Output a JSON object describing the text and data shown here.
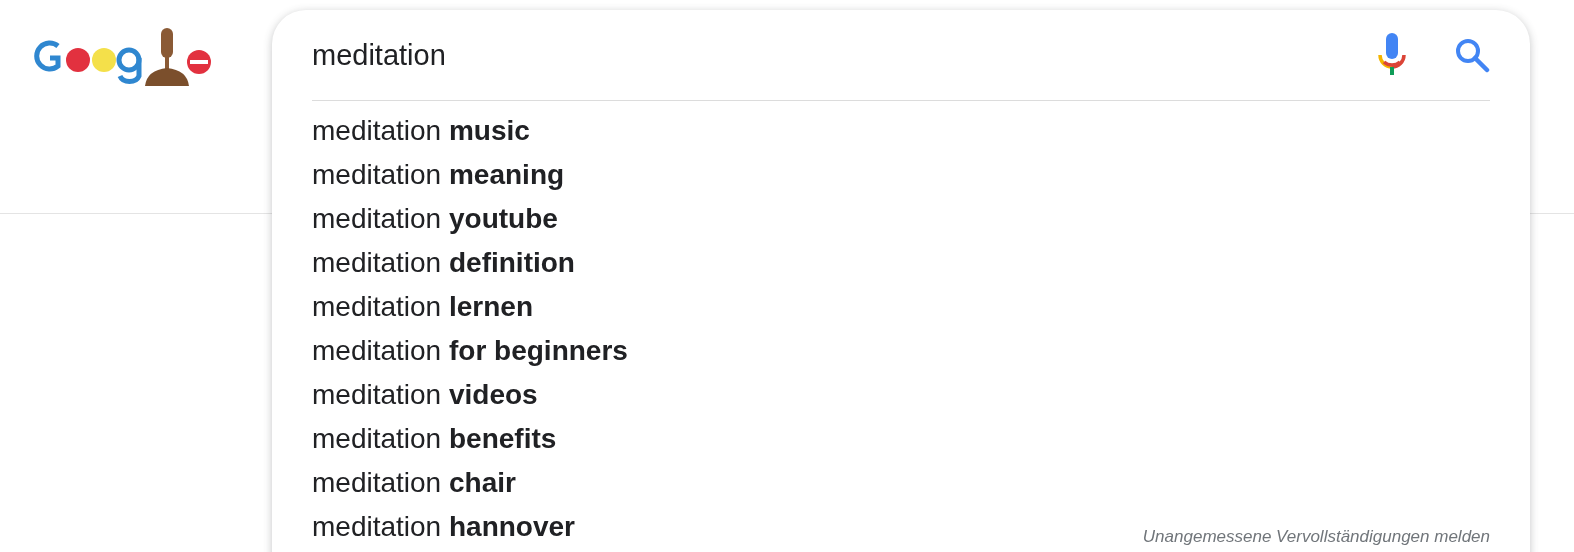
{
  "search": {
    "value": "meditation"
  },
  "suggestions": [
    {
      "text": "meditation **music**"
    },
    {
      "text": "meditation **meaning**"
    },
    {
      "text": "meditation **youtube**"
    },
    {
      "text": "meditation **definition**"
    },
    {
      "text": "meditation **lernen**"
    },
    {
      "text": "meditation **for beginners**"
    },
    {
      "text": "meditation **videos**"
    },
    {
      "text": "meditation **benefits**"
    },
    {
      "text": "meditation **chair**"
    },
    {
      "text": "meditation **hannover**"
    }
  ],
  "report_link": "Unangemessene Vervollständigungen melden"
}
